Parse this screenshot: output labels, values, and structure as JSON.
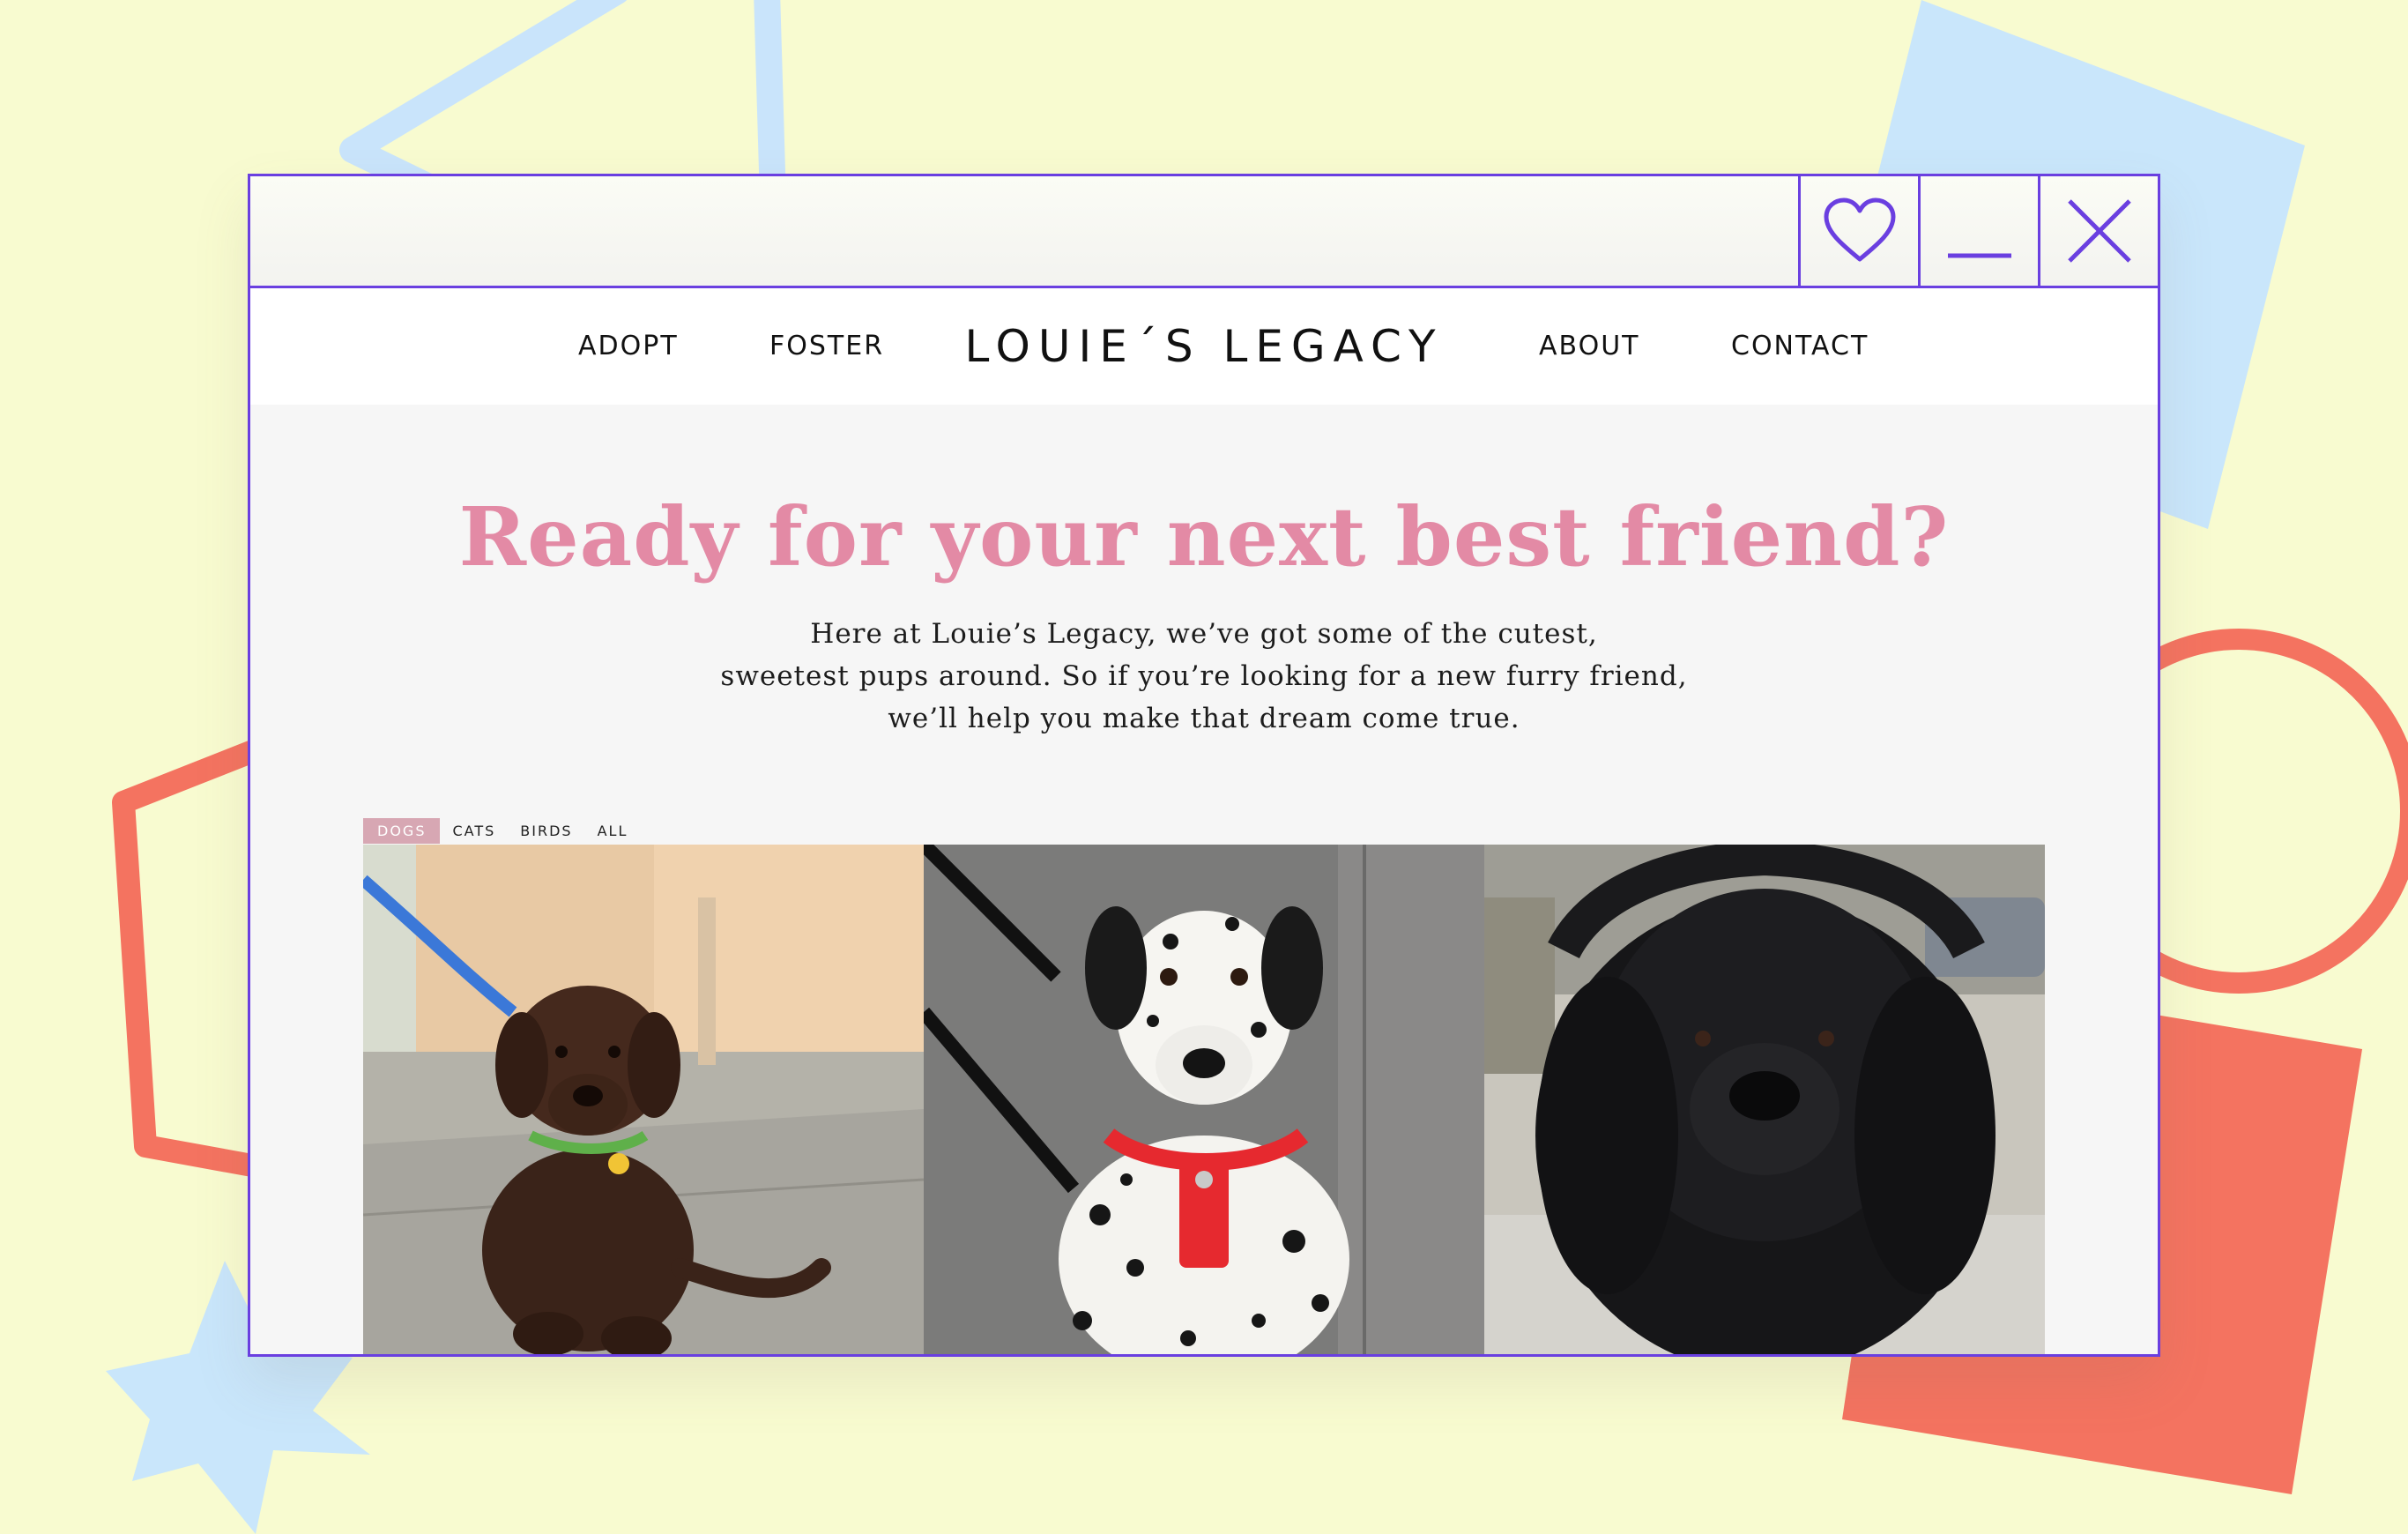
{
  "window": {
    "favorite_icon": "heart-icon",
    "minimize_icon": "minimize-icon",
    "close_icon": "close-icon",
    "accent": "#6a3fe0"
  },
  "nav": {
    "logo": "LOUIE´S LEGACY",
    "links": [
      "ADOPT",
      "FOSTER",
      "ABOUT",
      "CONTACT"
    ]
  },
  "hero": {
    "title": "Ready for your next best friend?",
    "text": [
      "Here at Louie’s Legacy, we’ve got some of the cutest,",
      "sweetest pups around. So if you’re looking for a new furry friend,",
      "we’ll help you make that dream come true."
    ],
    "title_color": "#e38aa5"
  },
  "filters": {
    "tabs": [
      "DOGS",
      "CATS",
      "BIRDS",
      "ALL"
    ],
    "active": "DOGS",
    "active_color": "#d7a7b3"
  },
  "gallery": {
    "photos": [
      "chocolate-labrador-puppy",
      "dalmatian",
      "newfoundland"
    ]
  }
}
